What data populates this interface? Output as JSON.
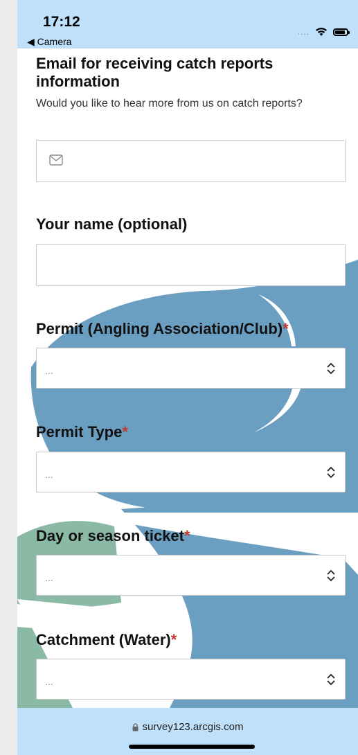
{
  "status_bar": {
    "time": "17:12",
    "back_label": "◀ Camera",
    "signal_dots": "....",
    "icons": [
      "wifi-icon",
      "battery-icon"
    ]
  },
  "form": {
    "email_question": {
      "title": "Email for receiving catch reports information",
      "hint": "Would you like to hear more from us on catch reports?",
      "value": "",
      "icon": "mail-icon"
    },
    "name_question": {
      "title": "Your name (optional)",
      "value": ""
    },
    "permit_question": {
      "title": "Permit (Angling Association/Club)",
      "required_mark": "*",
      "selected": "..."
    },
    "permit_type_question": {
      "title": "Permit Type",
      "required_mark": "*",
      "selected": "..."
    },
    "ticket_question": {
      "title": "Day or season ticket",
      "required_mark": "*",
      "selected": "..."
    },
    "catchment_question": {
      "title": "Catchment (Water)",
      "required_mark": "*",
      "selected": "..."
    }
  },
  "browser": {
    "url": "survey123.arcgis.com",
    "icon": "lock-icon"
  },
  "colors": {
    "bars": "#bfe0fa",
    "fish_blue": "#6b9fc1",
    "teal": "#8ab9a6",
    "required": "#c0392b"
  }
}
